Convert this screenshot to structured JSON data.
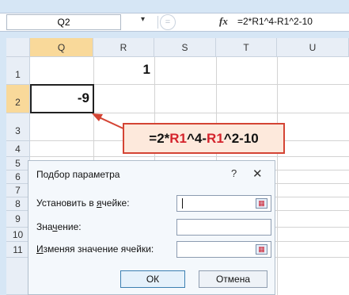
{
  "formula_bar": {
    "name_box": "Q2",
    "name_arrow": "▾",
    "cancel_glyph": "=",
    "fx_label": "fx",
    "formula": "=2*R1^4-R1^2-10"
  },
  "grid": {
    "columns": [
      "Q",
      "R",
      "S",
      "T",
      "U"
    ],
    "rows": [
      "1",
      "2",
      "3",
      "4",
      "5",
      "6",
      "7",
      "8",
      "9",
      "10",
      "11"
    ],
    "cell_R1": "1",
    "cell_Q2": "-9"
  },
  "callout": {
    "part1": "=2*",
    "ref1": "R1",
    "part2": "^4-",
    "ref2": "R1",
    "part3": "^2-10",
    "border_color": "#d44434",
    "ref_color": "#d4232c"
  },
  "dialog": {
    "title": "Подбор параметра",
    "help": "?",
    "close": "✕",
    "set_cell_label_pre": "Установить в ",
    "set_cell_label_u": "я",
    "set_cell_label_post": "чейке:",
    "value_label_pre": "Зна",
    "value_label_u": "ч",
    "value_label_post": "ение:",
    "changing_label_u": "И",
    "changing_label_post": "зменяя значение ячейки:",
    "ok": "ОК",
    "cancel": "Отмена"
  },
  "colors": {
    "background": "#d6e6f5",
    "active_header": "#f9d99a",
    "arrow": "#d44434"
  }
}
